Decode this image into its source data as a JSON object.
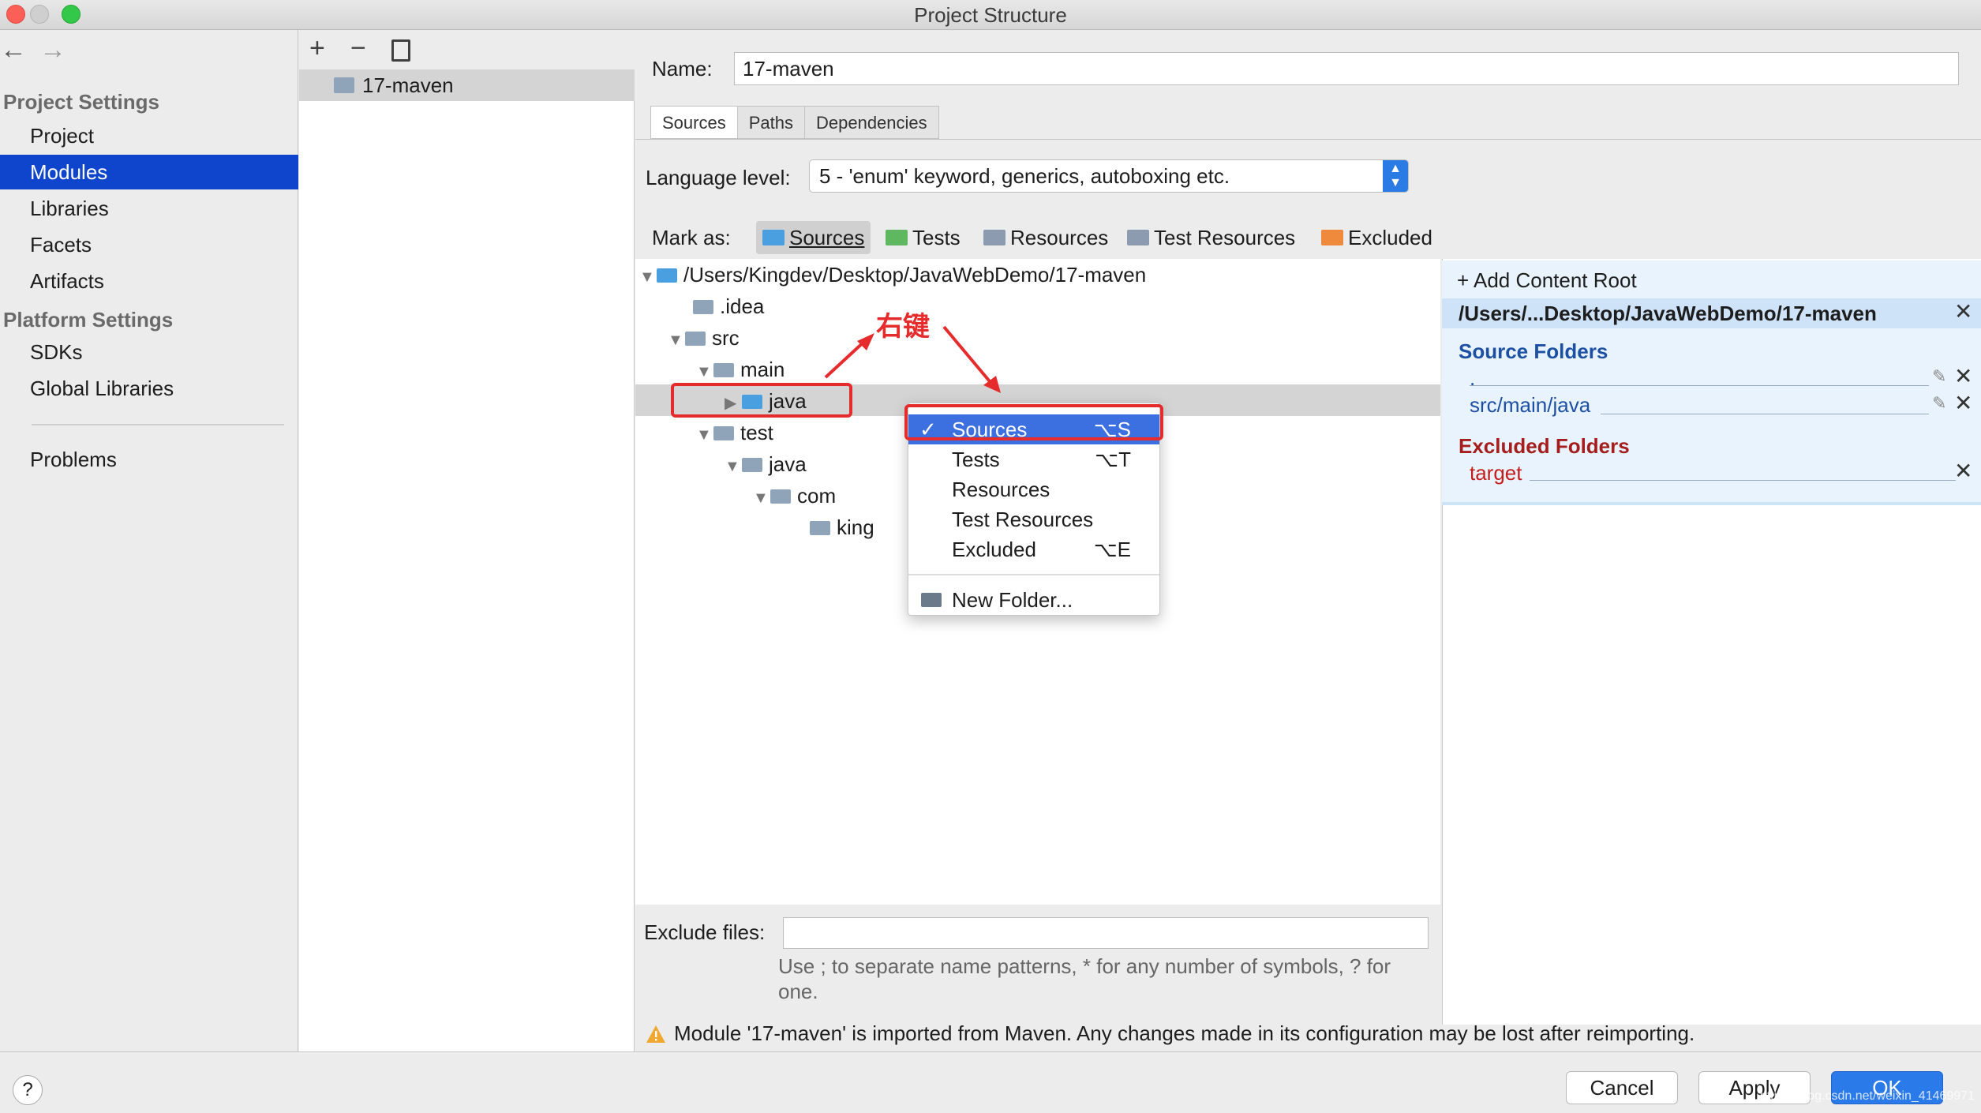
{
  "window": {
    "title": "Project Structure"
  },
  "sidebar": {
    "project_settings": "Project Settings",
    "items_top": [
      "Project",
      "Modules",
      "Libraries",
      "Facets",
      "Artifacts"
    ],
    "platform_settings": "Platform Settings",
    "items_platform": [
      "SDKs",
      "Global Libraries"
    ],
    "problems": "Problems",
    "selected": "Modules"
  },
  "modules": {
    "toolbar": [
      "+",
      "−",
      "copy"
    ],
    "items": [
      "17-maven"
    ]
  },
  "main": {
    "name_label": "Name:",
    "name_value": "17-maven",
    "tabs": [
      "Sources",
      "Paths",
      "Dependencies"
    ],
    "active_tab": "Sources",
    "language_level_label": "Language level:",
    "language_level_value": "5 - 'enum' keyword, generics, autoboxing etc.",
    "mark_as_label": "Mark as:",
    "mark_as": [
      {
        "label": "Sources",
        "color": "#4a9fe0"
      },
      {
        "label": "Tests",
        "color": "#5fb85f"
      },
      {
        "label": "Resources",
        "color": "#8c9bb0"
      },
      {
        "label": "Test Resources",
        "color": "#8c9bb0"
      },
      {
        "label": "Excluded",
        "color": "#ef8a3c"
      }
    ],
    "tree": {
      "root": "/Users/Kingdev/Desktop/JavaWebDemo/17-maven",
      "idea": ".idea",
      "src": "src",
      "main": "main",
      "java": "java",
      "test": "test",
      "test_java": "java",
      "com": "com",
      "king": "king"
    },
    "annotation": "右键",
    "context_menu": [
      {
        "label": "Sources",
        "shortcut": "⌥S",
        "checked": true
      },
      {
        "label": "Tests",
        "shortcut": "⌥T"
      },
      {
        "label": "Resources",
        "shortcut": ""
      },
      {
        "label": "Test Resources",
        "shortcut": ""
      },
      {
        "label": "Excluded",
        "shortcut": "⌥E"
      },
      {
        "label": "New Folder...",
        "shortcut": ""
      }
    ],
    "exclude_files_label": "Exclude files:",
    "exclude_files_value": "",
    "hint": "Use ; to separate name patterns, * for any number of symbols, ? for one.",
    "warning": "Module '17-maven' is imported from Maven. Any changes made in its configuration may be lost after reimporting."
  },
  "content_root": {
    "add_label": "Add Content Root",
    "root_path": "/Users/...Desktop/JavaWebDemo/17-maven",
    "source_folders_label": "Source Folders",
    "source_folders": [
      ".",
      "src/main/java"
    ],
    "excluded_folders_label": "Excluded Folders",
    "excluded_folders": [
      "target"
    ]
  },
  "buttons": {
    "cancel": "Cancel",
    "apply": "Apply",
    "ok": "OK",
    "help": "?"
  },
  "watermark": "https://blog.csdn.net/weixin_41469971"
}
